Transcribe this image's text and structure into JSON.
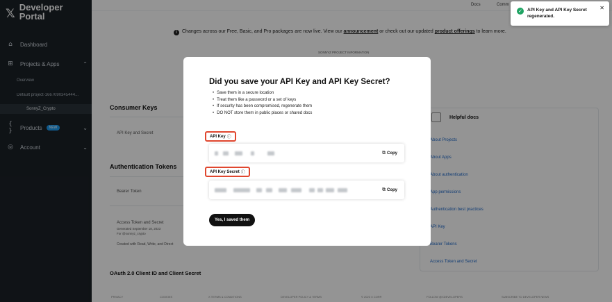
{
  "sidebar": {
    "logo_icon": "x-logo-icon",
    "brand_line1": "Developer",
    "brand_line2": "Portal",
    "dashboard": "Dashboard",
    "projects_apps": "Projects & Apps",
    "overview": "Overview",
    "default_project": "Default project-1667090345444...",
    "app_name": "SonnyZ_Crypto",
    "products": "Products",
    "products_badge": "NEW",
    "account": "Account"
  },
  "topbar": {
    "docs": "Docs",
    "community": "Comm"
  },
  "banner": {
    "text_before": "Changes across our Free, Basic, and Pro packages are now live. View our ",
    "link1": "announcement",
    "text_middle": " or check out our updated ",
    "link2": "product offerings",
    "text_after": " to learn more."
  },
  "main": {
    "app_subtitle": "SONNYZ PROJECT INFORMATION",
    "consumer_keys": "Consumer Keys",
    "api_key_and_secret": "API Key and Secret",
    "auth_tokens": "Authentication Tokens",
    "bearer_token": "Bearer Token",
    "access_token": "Access Token and Secret",
    "access_token_meta1": "Generated September 18, 2023",
    "access_token_meta2": "For @sonnyz_crypto",
    "access_token_meta3": "Created with Read, Write, and Direct",
    "oauth2": "OAuth 2.0 Client ID and Client Secret",
    "footer": [
      "PRIVACY",
      "COOKIES",
      "X TERMS & CONDITIONS",
      "DEVELOPER POLICY & TERMS",
      "© 2023 X CORP.",
      "FOLLOW @XDEVELOPERS",
      "SUBSCRIBE TO DEVELOPER NEWS"
    ]
  },
  "helpful_docs": {
    "title": "Helpful docs",
    "links": [
      "About Projects",
      "About Apps",
      "About authentication",
      "App permissions",
      "Authentication best practices",
      "API Key",
      "Bearer Tokens",
      "Access Token and Secret"
    ]
  },
  "modal": {
    "title": "Did you save your API Key and API Key Secret?",
    "bullets": [
      "Save them in a secure location",
      "Treat them like a password or a set of keys",
      "If security has been compromised, regenerate them",
      "DO NOT store them in public places or shared docs"
    ],
    "api_key_label": "API Key",
    "api_secret_label": "API Key Secret",
    "copy_label": "Copy",
    "confirm_button": "Yes, I saved them",
    "highlight_color": "#e0462e"
  },
  "toast": {
    "message": "API Key and API Key Secret regenerated.",
    "status_color": "#1fa463"
  }
}
